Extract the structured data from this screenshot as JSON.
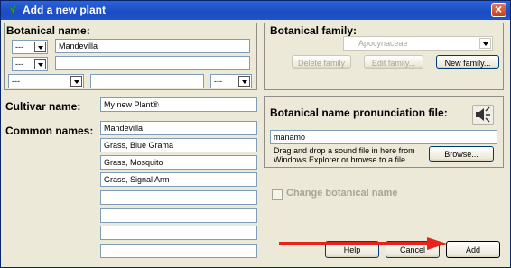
{
  "window": {
    "title": "Add a new plant"
  },
  "botanical_name": {
    "label": "Botanical name:",
    "rows": [
      {
        "prefix": "---",
        "value": "Mandevilla"
      },
      {
        "prefix": "---",
        "value": ""
      },
      {
        "prefix": "---",
        "value": "",
        "suffix": "---"
      }
    ]
  },
  "botanical_family": {
    "label": "Botanical family:",
    "selected": "Apocynaceae",
    "delete_label": "Delete family",
    "edit_label": "Edit family...",
    "new_label": "New family..."
  },
  "cultivar": {
    "label": "Cultivar name:",
    "value": "My new Plant®"
  },
  "common_names": {
    "label": "Common names:",
    "values": [
      "Mandevilla",
      "Grass, Blue Grama",
      "Grass, Mosquito",
      "Grass, Signal Arm",
      "",
      "",
      "",
      ""
    ]
  },
  "pronunciation": {
    "label": "Botanical name pronunciation file:",
    "value": "manamo",
    "hint_line1": "Drag and drop a sound file in here from",
    "hint_line2": "Windows Explorer or browse to a file",
    "browse_label": "Browse...",
    "speaker_icon": "speaker-icon"
  },
  "change_botanical": {
    "label": "Change botanical name"
  },
  "footer": {
    "help_label": "Help",
    "cancel_label": "Cancel",
    "add_label": "Add"
  },
  "colors": {
    "titlebar": "#1a4cc3",
    "annotation_arrow": "#e8231c"
  }
}
